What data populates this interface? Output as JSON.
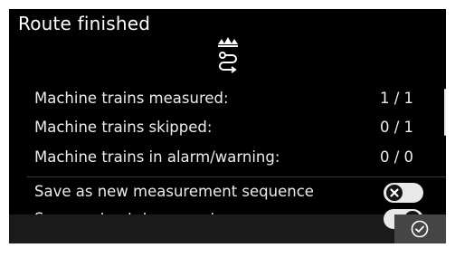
{
  "dialog": {
    "title": "Route finished"
  },
  "summary": [
    {
      "label": "Machine trains measured:",
      "value": "1 / 1"
    },
    {
      "label": "Machine trains skipped:",
      "value": "0 / 1"
    },
    {
      "label": "Machine trains in alarm/warning:",
      "value": "0 / 0"
    }
  ],
  "options": [
    {
      "label": "Save as new measurement sequence",
      "state": "off"
    },
    {
      "label": "Save route status report",
      "state": "on"
    }
  ],
  "icons": {
    "header": "route-finished-crown-icon",
    "confirm": "check-circle-icon",
    "toggle_off": "x-icon",
    "toggle_on": "check-icon"
  },
  "colors": {
    "background": "#000000",
    "text": "#ececec",
    "toggle_track": "#e8e8e8",
    "footer": "#1a1a1a",
    "confirm_button": "#454545"
  }
}
